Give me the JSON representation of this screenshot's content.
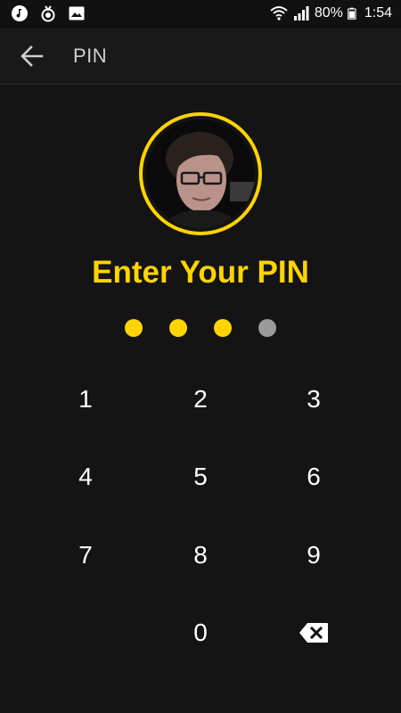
{
  "status_bar": {
    "battery_percent": "80%",
    "time": "1:54",
    "left_icons": [
      "music-notification-icon",
      "location-notification-icon",
      "image-notification-icon"
    ],
    "right_icons": [
      "wifi-icon",
      "signal-icon",
      "battery-icon"
    ]
  },
  "app_bar": {
    "back_icon": "arrow-left-icon",
    "title": "PIN"
  },
  "lock": {
    "heading": "Enter Your PIN",
    "pin_length": 4,
    "entered_count": 3,
    "colors": {
      "accent": "#ffd400",
      "dot_filled": "#ffd400",
      "dot_empty": "#9b9b9b",
      "background": "#141414"
    }
  },
  "keypad": {
    "keys": [
      {
        "label": "1"
      },
      {
        "label": "2"
      },
      {
        "label": "3"
      },
      {
        "label": "4"
      },
      {
        "label": "5"
      },
      {
        "label": "6"
      },
      {
        "label": "7"
      },
      {
        "label": "8"
      },
      {
        "label": "9"
      },
      {
        "label": ""
      },
      {
        "label": "0"
      },
      {
        "label": "",
        "icon": "backspace-icon"
      }
    ]
  }
}
